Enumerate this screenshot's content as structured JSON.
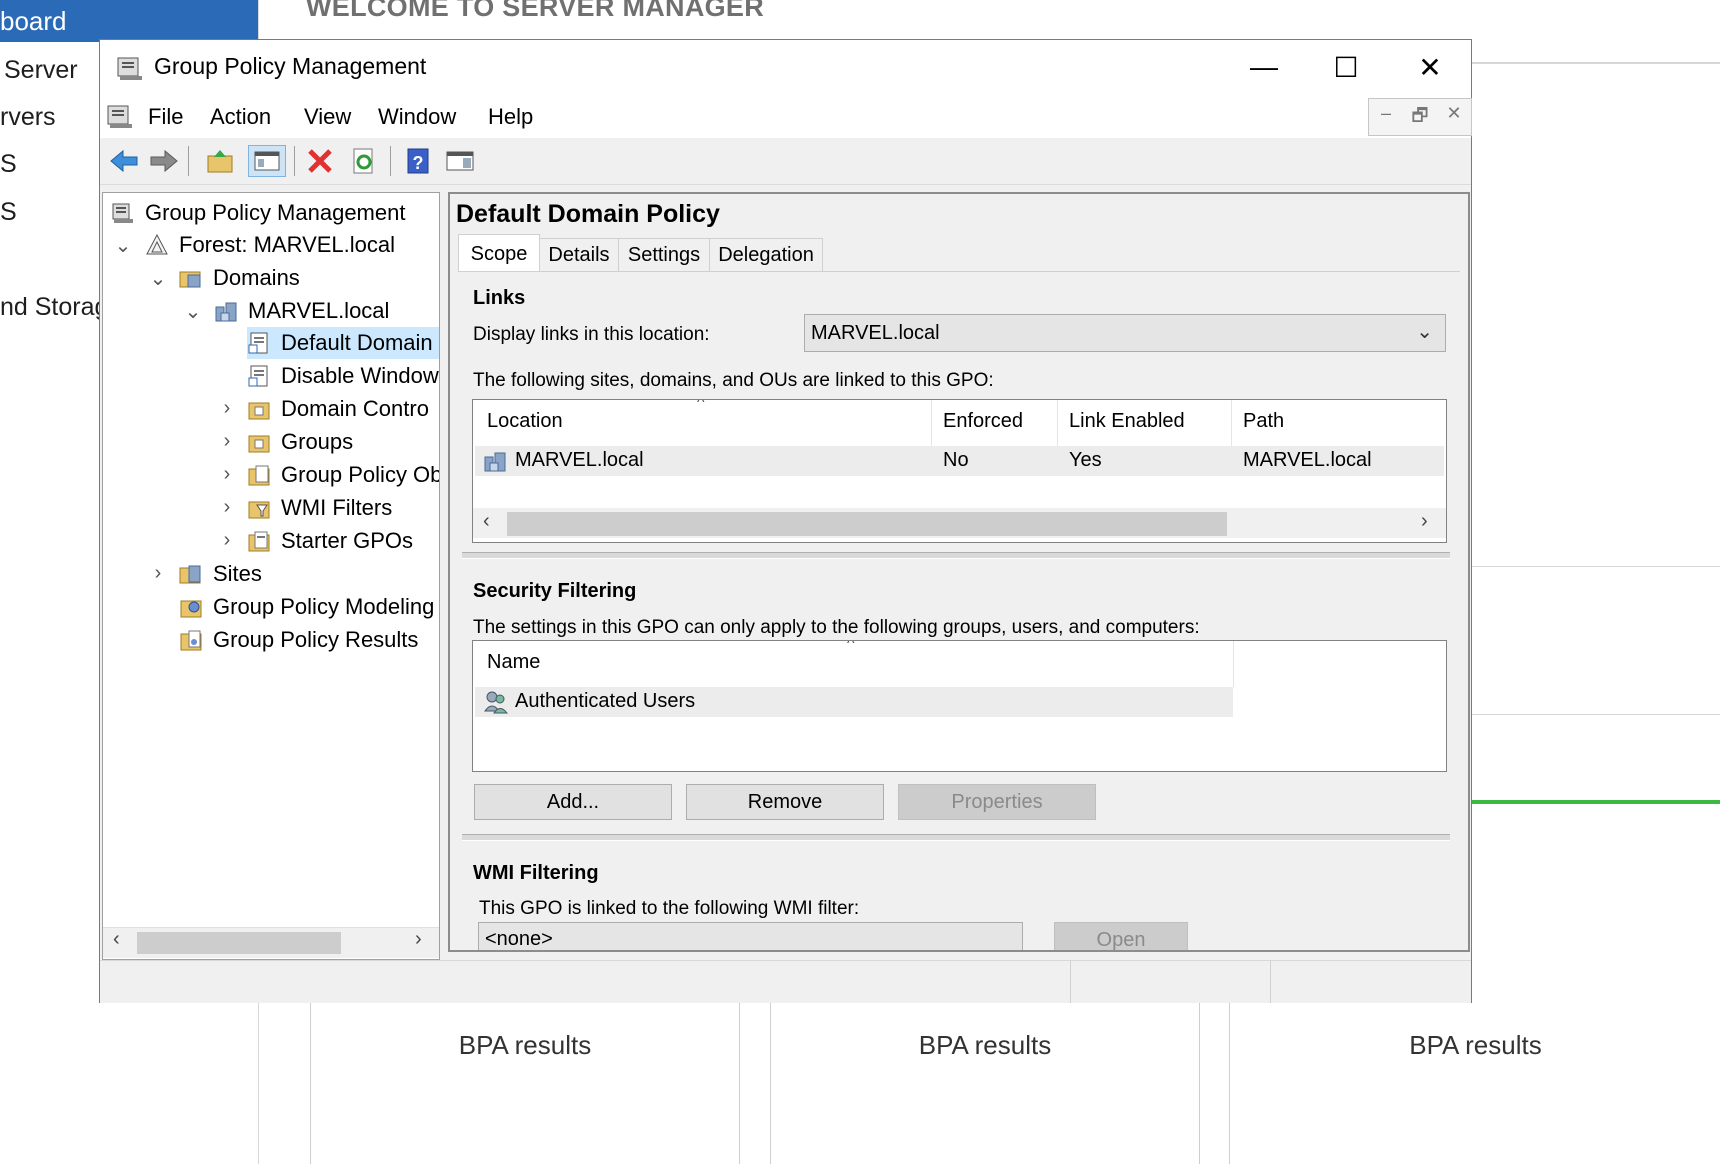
{
  "background": {
    "sidebar_items": [
      "board",
      "Server",
      "rvers",
      "S",
      "S",
      "nd Storag"
    ],
    "welcome": "WELCOME TO SERVER MANAGER",
    "bpa_cards": [
      "BPA results",
      "BPA results",
      "BPA results"
    ],
    "accent_green": "#3cb943",
    "selected_color": "#2a6ab7"
  },
  "window": {
    "title": "Group Policy Management",
    "controls": {
      "minimize": "—",
      "maximize": "☐",
      "close": "✕"
    },
    "menu": [
      "File",
      "Action",
      "View",
      "Window",
      "Help"
    ],
    "mdi_controls": [
      "–",
      "🗗",
      "✕"
    ],
    "toolbar_icons": [
      "back-arrow-icon",
      "forward-arrow-icon",
      "up-folder-icon",
      "show-hide-console-tree-icon",
      "delete-icon",
      "refresh-icon",
      "help-icon",
      "properties-pane-icon"
    ]
  },
  "tree": {
    "root": "Group Policy Management",
    "forest": "Forest: MARVEL.local",
    "domains": "Domains",
    "domain": "MARVEL.local",
    "children": [
      "Default Domain",
      "Disable Window",
      "Domain Contro",
      "Groups",
      "Group Policy Ob",
      "WMI Filters",
      "Starter GPOs"
    ],
    "sites": "Sites",
    "modeling": "Group Policy Modeling",
    "results": "Group Policy Results"
  },
  "detail": {
    "title": "Default Domain Policy",
    "tabs": [
      "Scope",
      "Details",
      "Settings",
      "Delegation"
    ],
    "links": {
      "heading": "Links",
      "display_label": "Display links in this location:",
      "location_value": "MARVEL.local",
      "description": "The following sites, domains, and OUs are linked to this GPO:",
      "columns": [
        "Location",
        "Enforced",
        "Link Enabled",
        "Path"
      ],
      "rows": [
        {
          "location": "MARVEL.local",
          "enforced": "No",
          "link_enabled": "Yes",
          "path": "MARVEL.local"
        }
      ]
    },
    "security": {
      "heading": "Security Filtering",
      "description": "The settings in this GPO can only apply to the following groups, users, and computers:",
      "columns": [
        "Name"
      ],
      "rows": [
        "Authenticated Users"
      ],
      "buttons": {
        "add": "Add...",
        "remove": "Remove",
        "properties": "Properties"
      }
    },
    "wmi": {
      "heading": "WMI Filtering",
      "description": "This GPO is linked to the following WMI filter:",
      "value": "<none>",
      "open_button": "Open"
    }
  }
}
